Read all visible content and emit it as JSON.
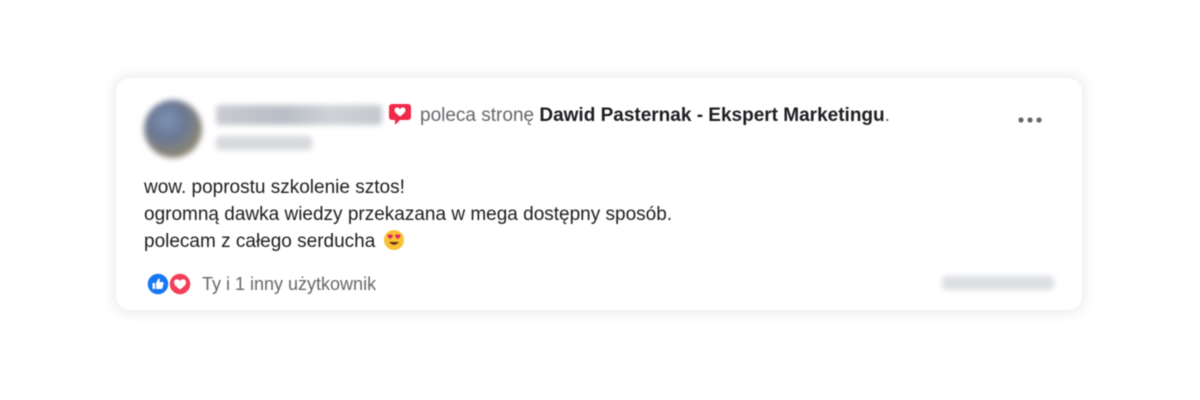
{
  "post": {
    "recommends_text": "poleca stronę",
    "page_name": "Dawid Pasternak - Ekspert Marketingu",
    "page_suffix": ".",
    "lines": [
      "wow.  poprostu szkolenie sztos!",
      "ogromną dawka wiedzy przekazana w mega dostępny sposób.",
      "polecam z całego serducha"
    ],
    "emoji": "heart-eyes-emoji",
    "reactions": {
      "icons": [
        "like-icon",
        "love-icon"
      ],
      "text": "Ty i 1 inny użytkownik"
    }
  },
  "colors": {
    "like": "#1877f2",
    "love": "#f33e58",
    "recommend": "#f02849",
    "secondary_text": "#65676b",
    "primary_text": "#1c1e21"
  }
}
